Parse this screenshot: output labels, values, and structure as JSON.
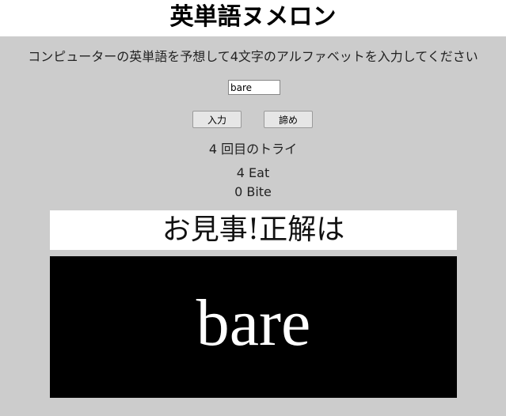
{
  "header": {
    "title": "英単語ヌメロン"
  },
  "instruction": "コンピューターの英単語を予想して4文字のアルファベットを入力してください",
  "guess_input": {
    "value": "bare"
  },
  "buttons": {
    "enter_label": "入力",
    "giveup_label": "諦め"
  },
  "status": {
    "tries": "4 回目のトライ",
    "eat": "4 Eat",
    "bite": "0 Bite"
  },
  "result": {
    "congrats": "お見事!正解は",
    "answer": "bare"
  },
  "colors": {
    "background": "#cccccc",
    "header_bg": "#ffffff",
    "answer_bg": "#000000",
    "answer_text": "#ffffff"
  }
}
